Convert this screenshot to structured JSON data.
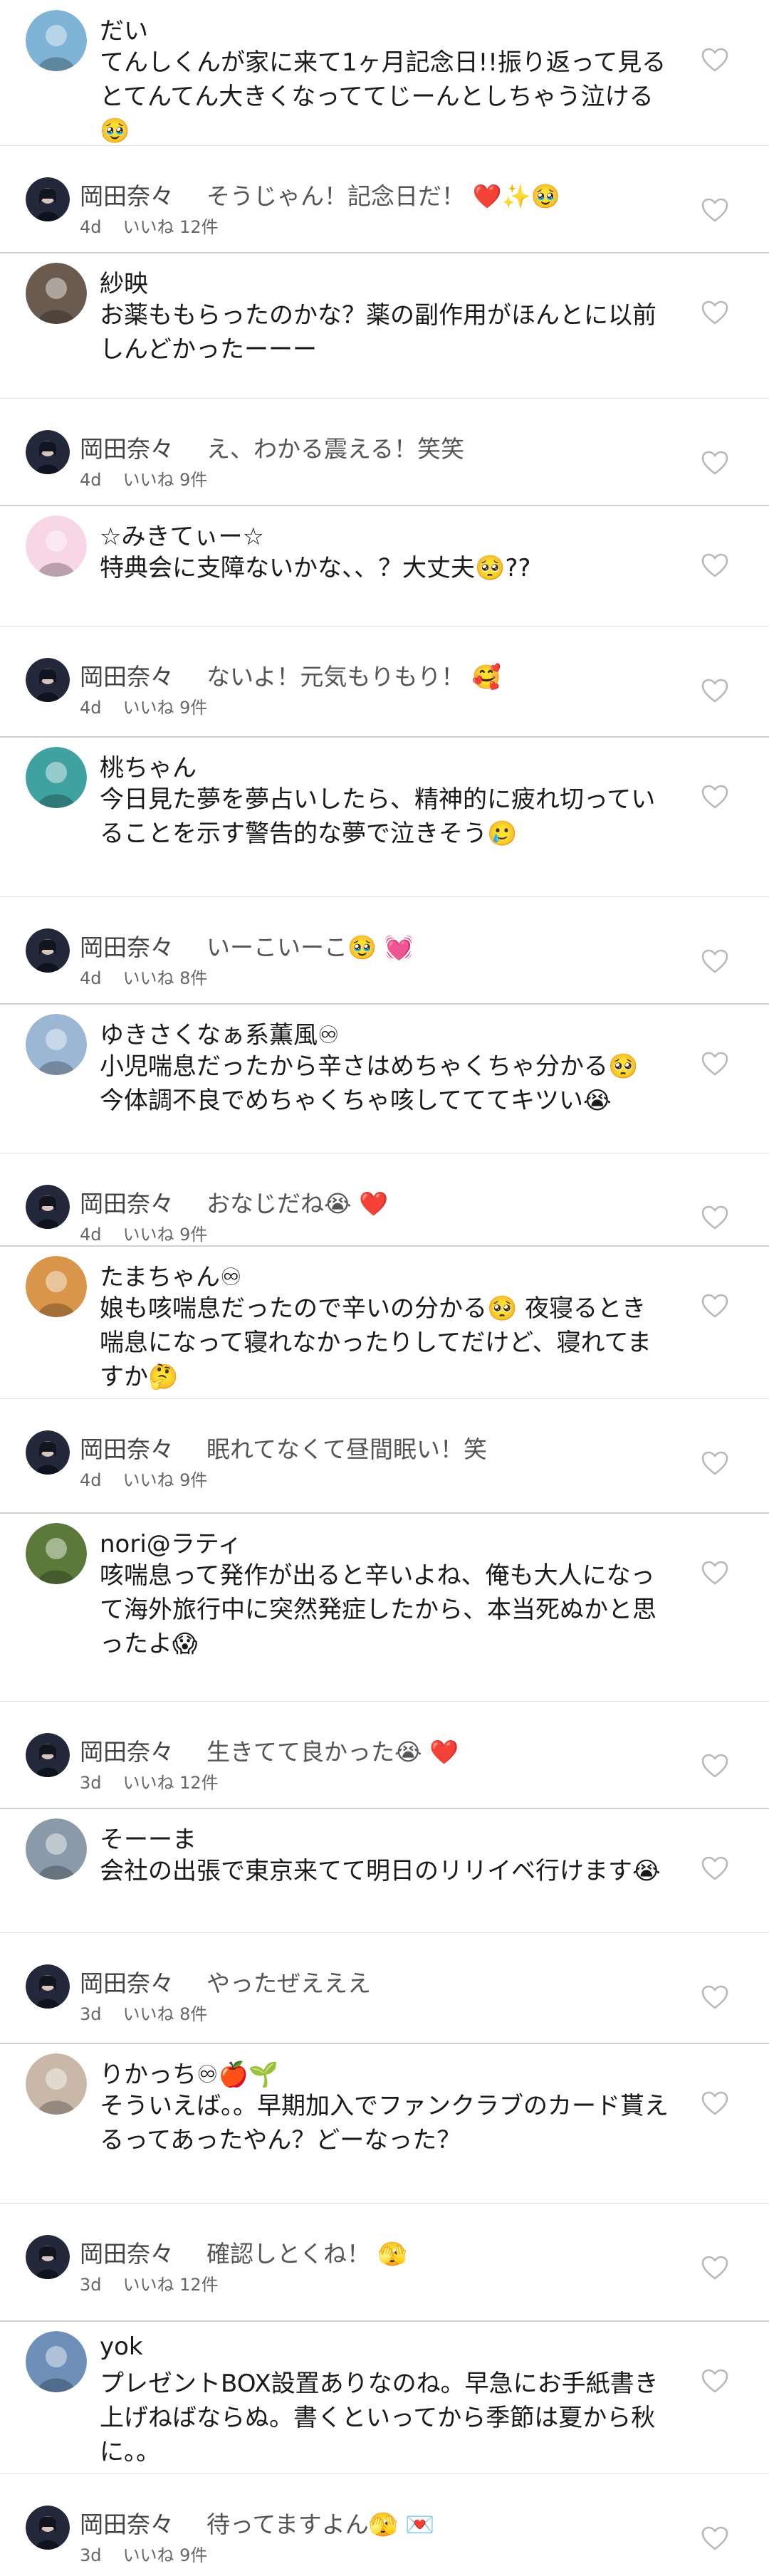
{
  "comments": [
    {
      "kind": "comment",
      "name": "だい",
      "text": "てんしくんが家に来て1ヶ月記念日!!振り返って見るとてんてん大きくなっててじーんとしちゃう泣ける🥹",
      "avatar_color": "#7fb3d5"
    },
    {
      "kind": "reply",
      "name": "岡田奈々",
      "text": "そうじゃん！記念日だ！ ❤️✨🥹",
      "time": "4d",
      "likes": "いいね 12件",
      "avatar_color": "#23283a"
    },
    {
      "kind": "comment",
      "name": "紗映",
      "text": "お薬ももらったのかな？薬の副作用がほんとに以前しんどかったーーー",
      "avatar_color": "#6b5a4e"
    },
    {
      "kind": "reply",
      "name": "岡田奈々",
      "text": "え、わかる震える！笑笑",
      "time": "4d",
      "likes": "いいね 9件",
      "avatar_color": "#23283a"
    },
    {
      "kind": "comment",
      "name": "☆みきてぃー☆",
      "text": "特典会に支障ないかな、、？大丈夫🥺??",
      "avatar_color": "#f7d6e6"
    },
    {
      "kind": "reply",
      "name": "岡田奈々",
      "text": "ないよ！元気もりもり！ 🥰",
      "time": "4d",
      "likes": "いいね 9件",
      "avatar_color": "#23283a"
    },
    {
      "kind": "comment",
      "name": "桃ちゃん",
      "text": "今日見た夢を夢占いしたら、精神的に疲れ切っていることを示す警告的な夢で泣きそう🥲",
      "avatar_color": "#3fa2a0"
    },
    {
      "kind": "reply",
      "name": "岡田奈々",
      "text": "いーこいーこ🥹 💓",
      "time": "4d",
      "likes": "いいね 8件",
      "avatar_color": "#23283a"
    },
    {
      "kind": "comment",
      "name": "ゆきさくなぁ系薫風♾",
      "text": "小児喘息だったから辛さはめちゃくちゃ分かる🥺 今体調不良でめちゃくちゃ咳してててキツい😭",
      "avatar_color": "#9bb7d4"
    },
    {
      "kind": "reply",
      "name": "岡田奈々",
      "text": "おなじだね😭 ❤️",
      "time": "4d",
      "likes": "いいね 9件",
      "avatar_color": "#23283a"
    },
    {
      "kind": "comment",
      "name": "たまちゃん♾",
      "text": "娘も咳喘息だったので辛いの分かる🥺 夜寝るとき喘息になって寝れなかったりしてだけど、寝れてますか🤔",
      "avatar_color": "#d9954a"
    },
    {
      "kind": "reply",
      "name": "岡田奈々",
      "text": "眠れてなくて昼間眠い！笑",
      "time": "4d",
      "likes": "いいね 9件",
      "avatar_color": "#23283a"
    },
    {
      "kind": "comment",
      "name": "nori@ラティ",
      "text": "咳喘息って発作が出ると辛いよね、俺も大人になって海外旅行中に突然発症したから、本当死ぬかと思ったよ😱",
      "avatar_color": "#5b7a3a"
    },
    {
      "kind": "reply",
      "name": "岡田奈々",
      "text": "生きてて良かった😭 ❤️",
      "time": "3d",
      "likes": "いいね 12件",
      "avatar_color": "#23283a"
    },
    {
      "kind": "comment",
      "name": "そーーま",
      "text": "会社の出張で東京来てて明日のリリイベ行けます😭",
      "avatar_color": "#8a9aa8"
    },
    {
      "kind": "reply",
      "name": "岡田奈々",
      "text": "やったぜえええ",
      "time": "3d",
      "likes": "いいね 8件",
      "avatar_color": "#23283a"
    },
    {
      "kind": "comment",
      "name": "りかっち♾🍎🌱",
      "text": "そういえば。。早期加入でファンクラブのカード貰えるってあったやん？どーなった？",
      "avatar_color": "#c9b8a8"
    },
    {
      "kind": "reply",
      "name": "岡田奈々",
      "text": "確認しとくね！ 🫣",
      "time": "3d",
      "likes": "いいね 12件",
      "avatar_color": "#23283a"
    },
    {
      "kind": "comment",
      "name": "yok",
      "text": "プレゼントBOX設置ありなのね。早急にお手紙書き上げねばならぬ。書くといってから季節は夏から秋に。。",
      "avatar_color": "#6d8fb8"
    },
    {
      "kind": "reply",
      "name": "岡田奈々",
      "text": "待ってますよん🫣 💌",
      "time": "3d",
      "likes": "いいね 9件",
      "avatar_color": "#23283a"
    }
  ],
  "icons": {
    "heart": "heart-outline-icon"
  },
  "colors": {
    "separator": "#cfcfcf",
    "meta_text": "#666666",
    "text": "#1a1a1a"
  }
}
